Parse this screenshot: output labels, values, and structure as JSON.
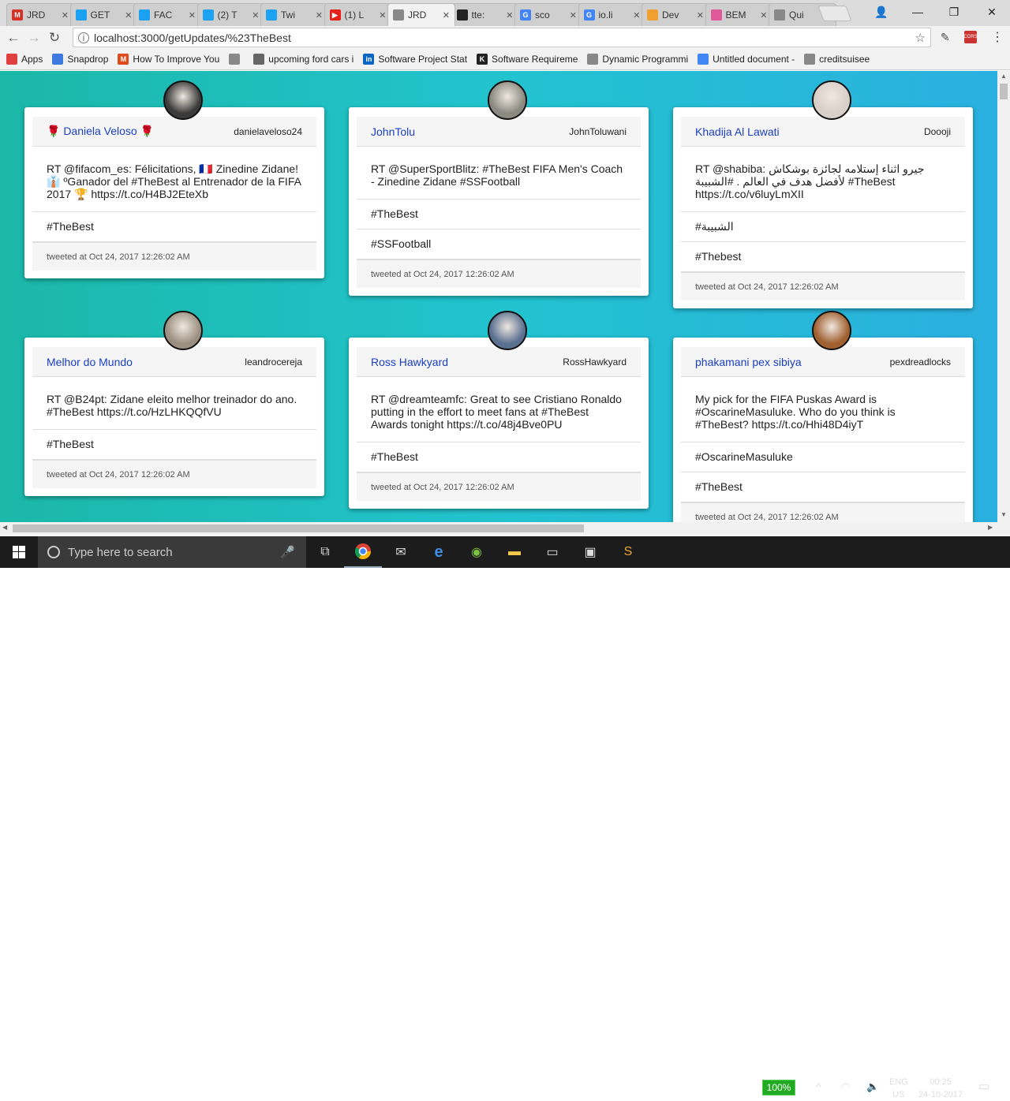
{
  "browser": {
    "tabs": [
      {
        "label": "JRD",
        "color": "#d93025",
        "icon": "M"
      },
      {
        "label": "GET",
        "color": "#1da1f2",
        "icon": ""
      },
      {
        "label": "FAC",
        "color": "#1da1f2",
        "icon": ""
      },
      {
        "label": "(2) T",
        "color": "#1da1f2",
        "icon": ""
      },
      {
        "label": "Twi",
        "color": "#1da1f2",
        "icon": ""
      },
      {
        "label": "(1) L",
        "color": "#e62117",
        "icon": "▶"
      },
      {
        "label": "JRD",
        "color": "#888888",
        "icon": ""
      },
      {
        "label": "tte:",
        "color": "#222222",
        "icon": ""
      },
      {
        "label": "sco",
        "color": "#4285f4",
        "icon": "G"
      },
      {
        "label": "io.li",
        "color": "#4285f4",
        "icon": "G"
      },
      {
        "label": "Dev",
        "color": "#f0a030",
        "icon": ""
      },
      {
        "label": "BEΜ",
        "color": "#e05a9a",
        "icon": ""
      },
      {
        "label": "Qui",
        "color": "#888888",
        "icon": ""
      }
    ],
    "active_tab": 6,
    "url": "localhost:3000/getUpdates/%23TheBest",
    "bookmarks": [
      {
        "label": "Apps",
        "color": "#e04040",
        "icon": ""
      },
      {
        "label": "Snapdrop",
        "color": "#3f7ae0",
        "icon": ""
      },
      {
        "label": "How To Improve You",
        "color": "#e04a1a",
        "icon": "M"
      },
      {
        "label": "",
        "color": "#888888",
        "icon": ""
      },
      {
        "label": "upcoming ford cars i",
        "color": "#666666",
        "icon": ""
      },
      {
        "label": "Software Project Stat",
        "color": "#0a66c2",
        "icon": "in"
      },
      {
        "label": "Software Requireme",
        "color": "#222222",
        "icon": "K"
      },
      {
        "label": "Dynamic Programmi",
        "color": "#888888",
        "icon": ""
      },
      {
        "label": "Untitled document -",
        "color": "#4285f4",
        "icon": ""
      },
      {
        "label": "creditsuisee",
        "color": "#888888",
        "icon": ""
      }
    ]
  },
  "tweets": [
    {
      "name": "🌹 Daniela Veloso 🌹",
      "handle": "danielaveloso24",
      "text": "RT @fifacom_es: Félicitations, 🇫🇷 Zinedine Zidane! 👔 ºGanador del #TheBest al Entrenador de la FIFA 2017 🏆 https://t.co/H4BJ2EteXb",
      "tags": [
        "#TheBest"
      ],
      "time": "tweeted at Oct 24, 2017 12:26:02 AM",
      "avatar": "#3a3a3a"
    },
    {
      "name": "JohnTolu",
      "handle": "JohnToluwani",
      "text": "RT @SuperSportBlitz: #TheBest FIFA Men's Coach - Zinedine Zidane #SSFootball",
      "tags": [
        "#TheBest",
        "#SSFootball"
      ],
      "time": "tweeted at Oct 24, 2017 12:26:02 AM",
      "avatar": "#8a8a80"
    },
    {
      "name": "Khadija Al Lawati",
      "handle": "Doooji",
      "text": "RT @shabiba: جيرو اثناء إستلامه لجائزة بوشكاش لأفضل هدف في العالم . #الشبيبة #TheBest https://t.co/v6luyLmXII",
      "tags": [
        "#الشبيبة",
        "#Thebest"
      ],
      "time": "tweeted at Oct 24, 2017 12:26:02 AM",
      "avatar": "#d8d0c8"
    },
    {
      "name": "Melhor do Mundo",
      "handle": "leandrocereja",
      "text": "RT @B24pt: Zidane eleito melhor treinador do ano. #TheBest https://t.co/HzLHKQQfVU",
      "tags": [
        "#TheBest"
      ],
      "time": "tweeted at Oct 24, 2017 12:26:02 AM",
      "avatar": "#9a8f80"
    },
    {
      "name": "Ross Hawkyard",
      "handle": "RossHawkyard",
      "text": "RT @dreamteamfc: Great to see Cristiano Ronaldo putting in the effort to meet fans at #TheBest Awards tonight https://t.co/48j4Bve0PU",
      "tags": [
        "#TheBest"
      ],
      "time": "tweeted at Oct 24, 2017 12:26:02 AM",
      "avatar": "#5a7090"
    },
    {
      "name": "phakamani pex sibiya",
      "handle": "pexdreadlocks",
      "text": "My pick for the FIFA Puskas Award is #OscarineMasuluke. Who do you think is #TheBest? https://t.co/Hhi48D4iyT",
      "tags": [
        "#OscarineMasuluke",
        "#TheBest"
      ],
      "time": "tweeted at Oct 24, 2017 12:26:02 AM",
      "avatar": "#a06030"
    }
  ],
  "taskbar": {
    "search_placeholder": "Type here to search",
    "battery": "100%",
    "lang": "ENG",
    "region": "US",
    "time": "00:25",
    "date": "24-10-2017"
  }
}
